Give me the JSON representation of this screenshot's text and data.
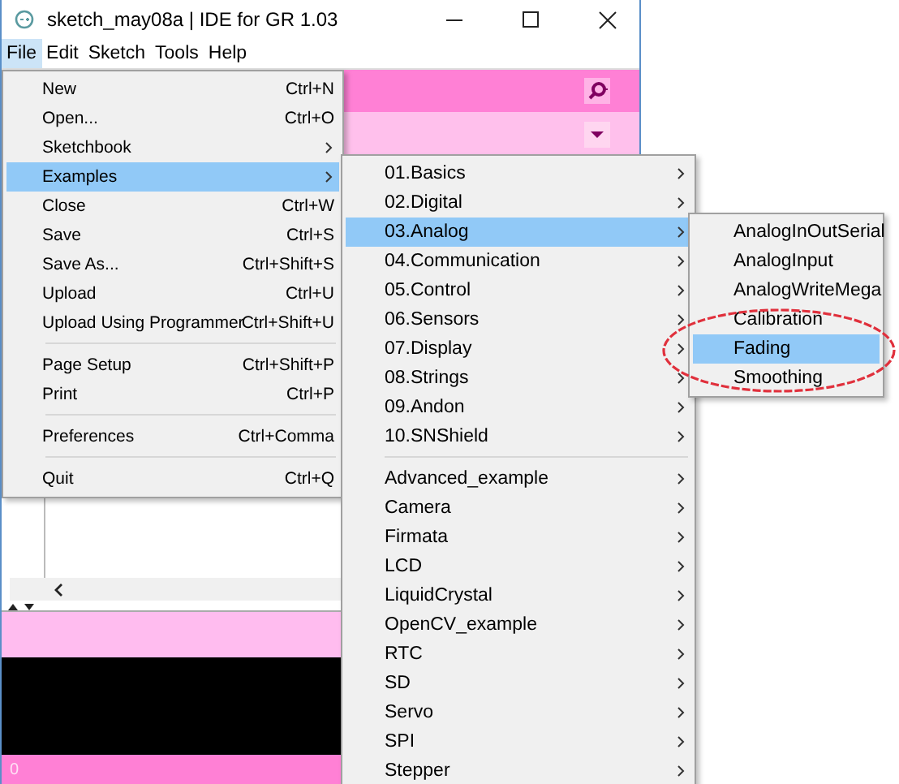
{
  "window": {
    "title": "sketch_may08a | IDE for GR 1.03"
  },
  "menu_bar": [
    {
      "label": "File",
      "selected": true
    },
    {
      "label": "Edit",
      "selected": false
    },
    {
      "label": "Sketch",
      "selected": false
    },
    {
      "label": "Tools",
      "selected": false
    },
    {
      "label": "Help",
      "selected": false
    }
  ],
  "file_menu": [
    {
      "kind": "item",
      "label": "New",
      "shortcut": "Ctrl+N",
      "submenu": false,
      "selected": false
    },
    {
      "kind": "item",
      "label": "Open...",
      "shortcut": "Ctrl+O",
      "submenu": false,
      "selected": false
    },
    {
      "kind": "item",
      "label": "Sketchbook",
      "submenu": true,
      "selected": false
    },
    {
      "kind": "item",
      "label": "Examples",
      "submenu": true,
      "selected": true
    },
    {
      "kind": "item",
      "label": "Close",
      "shortcut": "Ctrl+W",
      "submenu": false,
      "selected": false
    },
    {
      "kind": "item",
      "label": "Save",
      "shortcut": "Ctrl+S",
      "submenu": false,
      "selected": false
    },
    {
      "kind": "item",
      "label": "Save As...",
      "shortcut": "Ctrl+Shift+S",
      "submenu": false,
      "selected": false
    },
    {
      "kind": "item",
      "label": "Upload",
      "shortcut": "Ctrl+U",
      "submenu": false,
      "selected": false
    },
    {
      "kind": "item",
      "label": "Upload Using Programmer",
      "shortcut": "Ctrl+Shift+U",
      "submenu": false,
      "selected": false
    },
    {
      "kind": "separator"
    },
    {
      "kind": "item",
      "label": "Page Setup",
      "shortcut": "Ctrl+Shift+P",
      "submenu": false,
      "selected": false
    },
    {
      "kind": "item",
      "label": "Print",
      "shortcut": "Ctrl+P",
      "submenu": false,
      "selected": false
    },
    {
      "kind": "separator"
    },
    {
      "kind": "item",
      "label": "Preferences",
      "shortcut": "Ctrl+Comma",
      "submenu": false,
      "selected": false
    },
    {
      "kind": "separator"
    },
    {
      "kind": "item",
      "label": "Quit",
      "shortcut": "Ctrl+Q",
      "submenu": false,
      "selected": false
    }
  ],
  "examples_menu": [
    {
      "kind": "item",
      "label": "01.Basics",
      "submenu": true,
      "selected": false
    },
    {
      "kind": "item",
      "label": "02.Digital",
      "submenu": true,
      "selected": false
    },
    {
      "kind": "item",
      "label": "03.Analog",
      "submenu": true,
      "selected": true
    },
    {
      "kind": "item",
      "label": "04.Communication",
      "submenu": true,
      "selected": false
    },
    {
      "kind": "item",
      "label": "05.Control",
      "submenu": true,
      "selected": false
    },
    {
      "kind": "item",
      "label": "06.Sensors",
      "submenu": true,
      "selected": false
    },
    {
      "kind": "item",
      "label": "07.Display",
      "submenu": true,
      "selected": false
    },
    {
      "kind": "item",
      "label": "08.Strings",
      "submenu": true,
      "selected": false
    },
    {
      "kind": "item",
      "label": "09.Andon",
      "submenu": true,
      "selected": false
    },
    {
      "kind": "item",
      "label": "10.SNShield",
      "submenu": true,
      "selected": false
    },
    {
      "kind": "separator"
    },
    {
      "kind": "item",
      "label": "Advanced_example",
      "submenu": true,
      "selected": false
    },
    {
      "kind": "item",
      "label": "Camera",
      "submenu": true,
      "selected": false
    },
    {
      "kind": "item",
      "label": "Firmata",
      "submenu": true,
      "selected": false
    },
    {
      "kind": "item",
      "label": "LCD",
      "submenu": true,
      "selected": false
    },
    {
      "kind": "item",
      "label": "LiquidCrystal",
      "submenu": true,
      "selected": false
    },
    {
      "kind": "item",
      "label": "OpenCV_example",
      "submenu": true,
      "selected": false
    },
    {
      "kind": "item",
      "label": "RTC",
      "submenu": true,
      "selected": false
    },
    {
      "kind": "item",
      "label": "SD",
      "submenu": true,
      "selected": false
    },
    {
      "kind": "item",
      "label": "Servo",
      "submenu": true,
      "selected": false
    },
    {
      "kind": "item",
      "label": "SPI",
      "submenu": true,
      "selected": false
    },
    {
      "kind": "item",
      "label": "Stepper",
      "submenu": true,
      "selected": false
    }
  ],
  "analog_menu": [
    {
      "kind": "item",
      "label": "AnalogInOutSerial",
      "submenu": false,
      "selected": false
    },
    {
      "kind": "item",
      "label": "AnalogInput",
      "submenu": false,
      "selected": false
    },
    {
      "kind": "item",
      "label": "AnalogWriteMega",
      "submenu": false,
      "selected": false
    },
    {
      "kind": "item",
      "label": "Calibration",
      "submenu": false,
      "selected": false
    },
    {
      "kind": "item",
      "label": "Fading",
      "submenu": false,
      "selected": true
    },
    {
      "kind": "item",
      "label": "Smoothing",
      "submenu": false,
      "selected": false
    }
  ],
  "status_bar": {
    "line": "0"
  }
}
